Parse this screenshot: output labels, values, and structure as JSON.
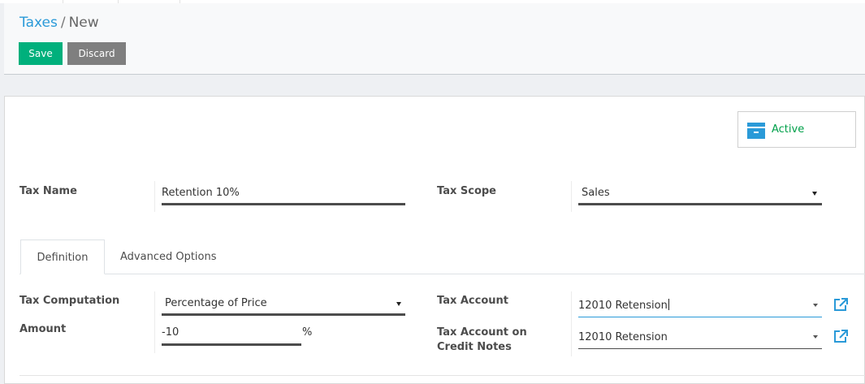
{
  "breadcrumb": {
    "parent": "Taxes",
    "separator": "/",
    "current": "New"
  },
  "actions": {
    "save": "Save",
    "discard": "Discard"
  },
  "status_button": {
    "label": "Active",
    "icon": "archive-icon"
  },
  "fields": {
    "tax_name": {
      "label": "Tax Name",
      "value": "Retention 10%"
    },
    "tax_scope": {
      "label": "Tax Scope",
      "value": "Sales"
    }
  },
  "tabs": [
    {
      "label": "Definition",
      "active": true
    },
    {
      "label": "Advanced Options",
      "active": false
    }
  ],
  "definition": {
    "tax_computation": {
      "label": "Tax Computation",
      "value": "Percentage of Price"
    },
    "amount": {
      "label": "Amount",
      "value": "-10",
      "unit": "%"
    },
    "tax_account": {
      "label": "Tax Account",
      "value": "12010 Retension"
    },
    "tax_account_credit_notes": {
      "label_line1": "Tax Account on",
      "label_line2": "Credit Notes",
      "value": "12010 Retension"
    }
  },
  "colors": {
    "primary": "#00b07c",
    "secondary": "#7f7f7f",
    "link": "#2a9ad8",
    "active": "#00a04a"
  }
}
